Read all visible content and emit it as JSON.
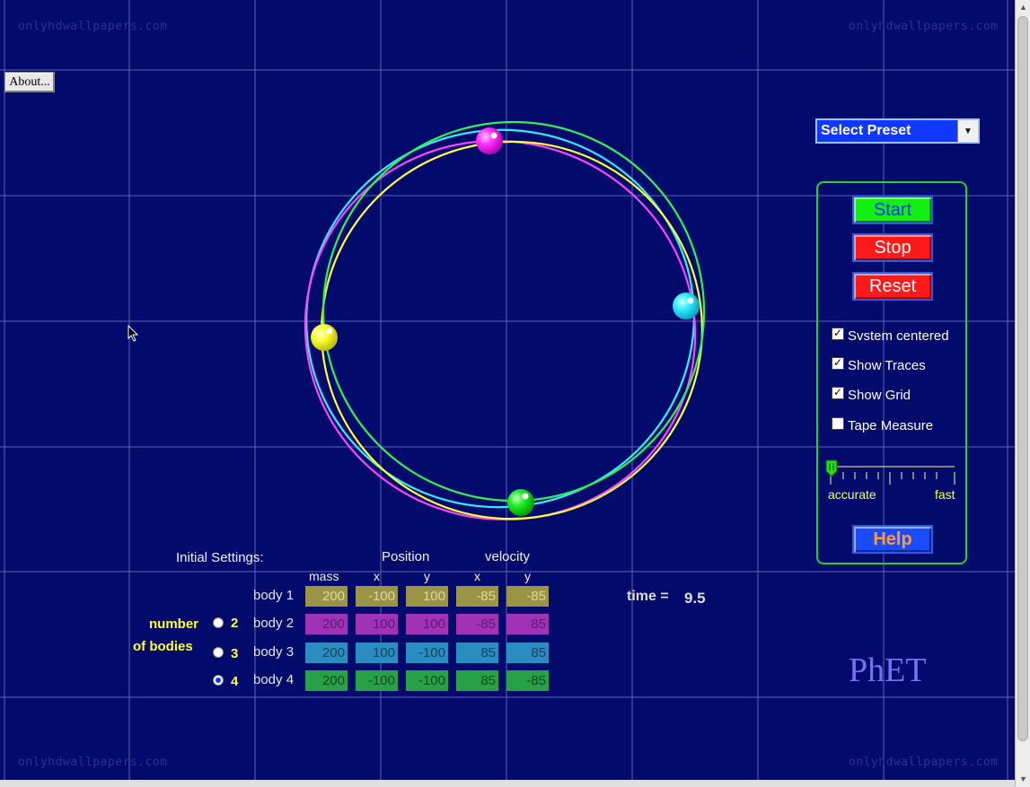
{
  "watermark": "onlyhdwallpapers.com",
  "about_button": "About...",
  "preset": {
    "label": "Select Preset"
  },
  "controls": {
    "start": "Start",
    "stop": "Stop",
    "reset": "Reset",
    "help": "Help"
  },
  "checkboxes": [
    {
      "label": "Svstem centered",
      "checked": true
    },
    {
      "label": "Show Traces",
      "checked": true
    },
    {
      "label": "Show Grid",
      "checked": true
    },
    {
      "label": "Tape Measure",
      "checked": false
    }
  ],
  "speed": {
    "left_label": "accurate",
    "right_label": "fast",
    "value": 0.0
  },
  "settings": {
    "title": "Initial Settings:",
    "position_header": "Position",
    "velocity_header": "velocity",
    "columns": [
      "mass",
      "x",
      "y",
      "x",
      "y"
    ],
    "bodies": [
      {
        "label": "body 1",
        "mass": "200",
        "x": "-100",
        "y": "100",
        "vx": "-85",
        "vy": "-85"
      },
      {
        "label": "body 2",
        "mass": "200",
        "x": "100",
        "y": "100",
        "vx": "-85",
        "vy": "85"
      },
      {
        "label": "body 3",
        "mass": "200",
        "x": "100",
        "y": "-100",
        "vx": "85",
        "vy": "85"
      },
      {
        "label": "body 4",
        "mass": "200",
        "x": "-100",
        "y": "-100",
        "vx": "85",
        "vy": "-85"
      }
    ],
    "number_of_bodies": {
      "line1": "number",
      "line2": "of bodies",
      "options": [
        "2",
        "3",
        "4"
      ],
      "selected": "4"
    }
  },
  "time": {
    "label": "time =",
    "value": "9.5"
  },
  "logo": "PhET",
  "colors": {
    "background": "#020a6b",
    "body1": "#ffff33",
    "body2": "#ff33ff",
    "body3": "#33eeff",
    "body4": "#33ee33"
  }
}
